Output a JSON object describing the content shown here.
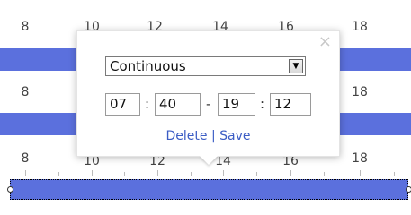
{
  "timeline": {
    "hour_labels": [
      "8",
      "10",
      "12",
      "14",
      "16",
      "18"
    ],
    "rows": [
      {
        "bar_color": "#5b70dd",
        "selected": false
      },
      {
        "bar_color": "#5b70dd",
        "selected": false
      },
      {
        "bar_color": "#5b70dd",
        "selected": true
      }
    ]
  },
  "popup": {
    "close_glyph": "×",
    "mode_value": "Continuous",
    "select_arrow_glyph": "▼",
    "start_hour": "07",
    "start_minute": "40",
    "end_hour": "19",
    "end_minute": "12",
    "time_colon": ":",
    "range_dash": "-",
    "delete_label": "Delete",
    "divider": "|",
    "save_label": "Save"
  },
  "colors": {
    "bar": "#5b70dd",
    "link": "#3b5cc4"
  }
}
